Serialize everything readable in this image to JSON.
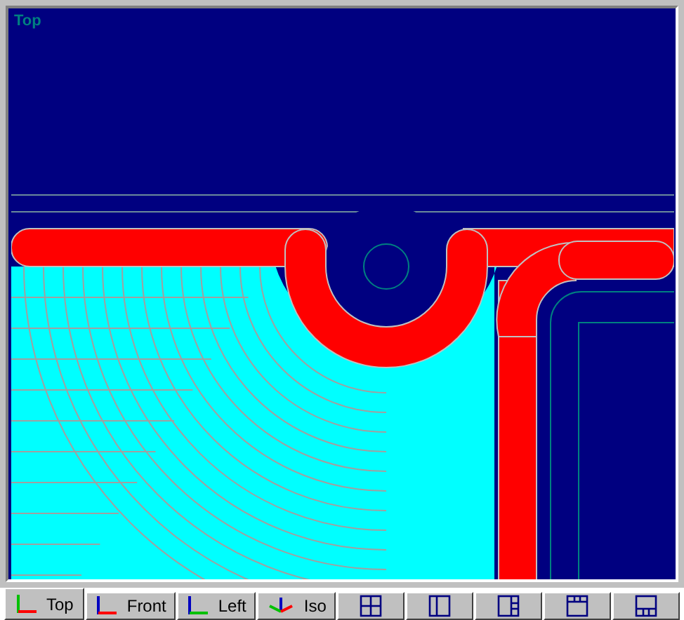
{
  "viewport": {
    "label": "Top"
  },
  "tabs": [
    {
      "kind": "top",
      "label": "Top",
      "selected": true
    },
    {
      "kind": "front",
      "label": "Front",
      "selected": false
    },
    {
      "kind": "left",
      "label": "Left",
      "selected": false
    },
    {
      "kind": "iso",
      "label": "Iso",
      "selected": false
    },
    {
      "kind": "quad",
      "selected": false
    },
    {
      "kind": "leftpane",
      "selected": false
    },
    {
      "kind": "rightpane",
      "selected": false
    },
    {
      "kind": "toppane",
      "selected": false
    },
    {
      "kind": "bottompane",
      "selected": false
    }
  ]
}
